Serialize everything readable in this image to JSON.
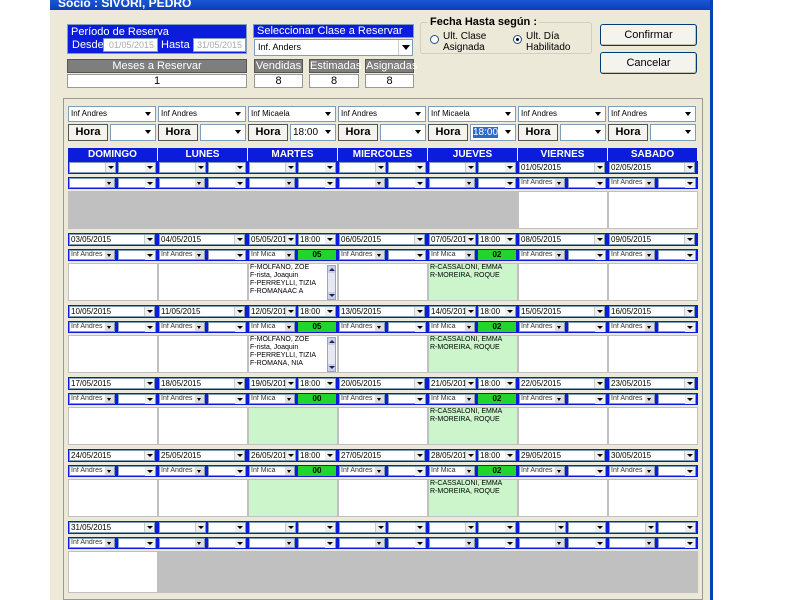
{
  "window": {
    "title": "Socio : SIVORI, PEDRO"
  },
  "reserva": {
    "periodo_label": "Período de Reserva",
    "desde_label": "Desde",
    "desde_value": "01/05/2015",
    "hasta_label": "Hasta :",
    "hasta_value": "31/05/2015",
    "meses_label": "Meses a Reservar",
    "meses_value": "1"
  },
  "clase": {
    "label": "Seleccionar Clase a Reservar",
    "value": "Inf. Anders"
  },
  "counts": {
    "vendidas_label": "Vendidas",
    "vendidas_value": "8",
    "estimadas_label": "Estimadas",
    "estimadas_value": "8",
    "asignadas_label": "Asignadas",
    "asignadas_value": "8"
  },
  "fecha_hasta": {
    "label": "Fecha Hasta según :",
    "opt1": "Ult. Clase Asignada",
    "opt2": "Ult. Día Habilitado",
    "selected": "opt2"
  },
  "buttons": {
    "confirmar": "Confirmar",
    "cancelar": "Cancelar"
  },
  "filters": {
    "class_values": [
      "Inf Andres",
      "Inf Andres",
      "Inf Micaela",
      "Inf Andres",
      "Inf Micaela",
      "Inf Andres",
      "Inf Andres"
    ],
    "hora_label": "Hora",
    "time_values": [
      "",
      "",
      "18:00",
      "",
      "18:00",
      "",
      ""
    ]
  },
  "days": [
    "DOMINGO",
    "LUNES",
    "MARTES",
    "MIERCOLES",
    "JUEVES",
    "VIERNES",
    "SABADO"
  ],
  "weeks": [
    [
      "",
      "",
      "",
      "",
      "",
      "01/05/2015",
      "02/05/2015"
    ],
    [
      "03/05/2015",
      "04/05/2015",
      "05/05/2015",
      "06/05/2015",
      "07/05/2015",
      "08/05/2015",
      "09/05/2015"
    ],
    [
      "10/05/2015",
      "11/05/2015",
      "12/05/2015",
      "13/05/2015",
      "14/05/2015",
      "15/05/2015",
      "16/05/2015"
    ],
    [
      "17/05/2015",
      "18/05/2015",
      "19/05/2015",
      "20/05/2015",
      "21/05/2015",
      "22/05/2015",
      "23/05/2015"
    ],
    [
      "24/05/2015",
      "25/05/2015",
      "26/05/2015",
      "27/05/2015",
      "28/05/2015",
      "29/05/2015",
      "30/05/2015"
    ],
    [
      "31/05/2015",
      "",
      "",
      "",
      "",
      "",
      ""
    ]
  ],
  "cells": {
    "class_andres": "Inf Andres",
    "class_micaela": "Inf Mica",
    "time": "18:00",
    "count_05": "05",
    "count_02": "02",
    "count_00": "00"
  },
  "students": {
    "martes_w2": [
      "F-MOLFANO, ZOE",
      "F-rista, Joaquin",
      "F-PERREYLLI, TIZIA",
      "F-ROMANAAC A"
    ],
    "jueves_w2": [
      "R-CASSALONI, EMMA",
      "R-MOREIRA, ROQUE"
    ],
    "martes_w3": [
      "F-MOLFANO, ZOE",
      "F-rista, Joaquin",
      "F-PERREYLLI, TIZIA",
      "F-ROMANA, NIA"
    ],
    "jueves_w3": [
      "R-CASSALONI, EMMA",
      "R-MOREIRA, ROQUE"
    ],
    "jueves_w4": [
      "R-CASSALONI, EMMA",
      "R-MOREIRA, ROQUE"
    ],
    "jueves_w5": [
      "R-CASSALONI, EMMA",
      "R-MOREIRA, ROQUE"
    ]
  },
  "colors": {
    "accent_blue": "#0b1cdd",
    "count_green": "#22d52b",
    "cell_green": "#ccf5cc",
    "cell_gray": "#c0c0c0"
  }
}
